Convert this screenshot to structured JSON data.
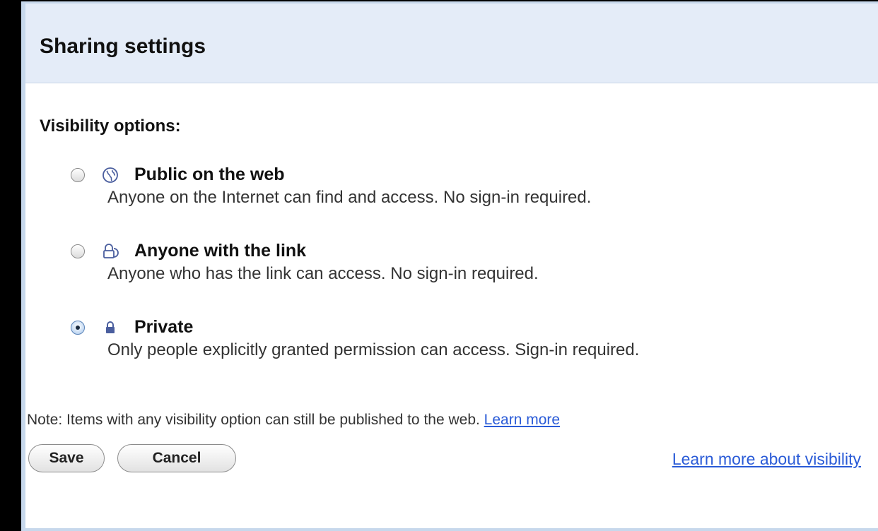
{
  "dialog": {
    "title": "Sharing settings",
    "section_label": "Visibility options:",
    "options": [
      {
        "label": "Public on the web",
        "description": "Anyone on the Internet can find and access. No sign-in required.",
        "icon": "globe-icon",
        "selected": false
      },
      {
        "label": "Anyone with the link",
        "description": "Anyone who has the link can access. No sign-in required.",
        "icon": "link-lock-icon",
        "selected": false
      },
      {
        "label": "Private",
        "description": "Only people explicitly granted permission can access. Sign-in required.",
        "icon": "lock-icon",
        "selected": true
      }
    ],
    "note_text": "Note: Items with any visibility option can still be published to the web.",
    "note_link": "Learn more",
    "save_label": "Save",
    "cancel_label": "Cancel",
    "visibility_link": "Learn more about visibility"
  },
  "colors": {
    "title_bar_bg": "#e4ecf8",
    "border": "#c7d8ec",
    "link": "#2a5bd7",
    "icon": "#4a5e9e"
  }
}
